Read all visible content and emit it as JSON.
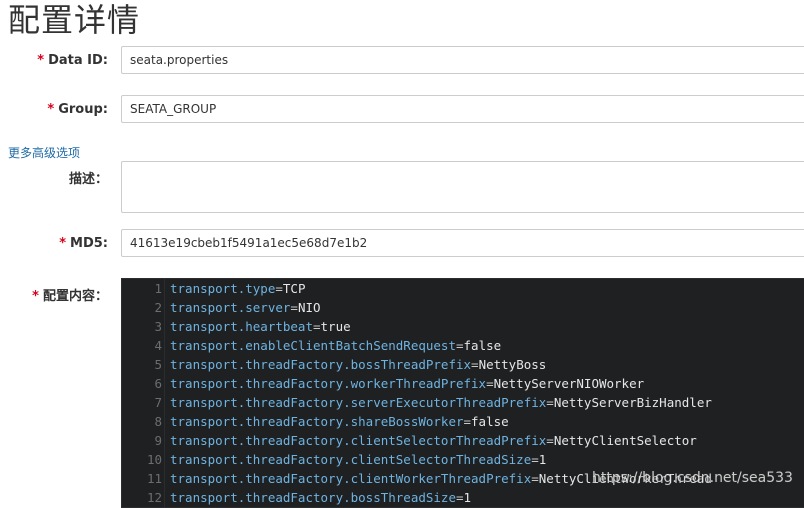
{
  "page_title": "配置详情",
  "form": {
    "data_id": {
      "label": "Data ID:",
      "value": "seata.properties"
    },
    "group": {
      "label": "Group:",
      "value": "SEATA_GROUP"
    },
    "advanced_link": "更多高级选项",
    "description": {
      "label": "描述：",
      "value": ""
    },
    "md5": {
      "label": "MD5:",
      "value": "41613e19cbeb1f5491a1ec5e68d7e1b2"
    },
    "content": {
      "label": "配置内容："
    },
    "required_mark": "*"
  },
  "editor": {
    "lines": [
      {
        "no": "1",
        "key": "transport.type",
        "value": "TCP"
      },
      {
        "no": "2",
        "key": "transport.server",
        "value": "NIO"
      },
      {
        "no": "3",
        "key": "transport.heartbeat",
        "value": "true"
      },
      {
        "no": "4",
        "key": "transport.enableClientBatchSendRequest",
        "value": "false"
      },
      {
        "no": "5",
        "key": "transport.threadFactory.bossThreadPrefix",
        "value": "NettyBoss"
      },
      {
        "no": "6",
        "key": "transport.threadFactory.workerThreadPrefix",
        "value": "NettyServerNIOWorker"
      },
      {
        "no": "7",
        "key": "transport.threadFactory.serverExecutorThreadPrefix",
        "value": "NettyServerBizHandler"
      },
      {
        "no": "8",
        "key": "transport.threadFactory.shareBossWorker",
        "value": "false"
      },
      {
        "no": "9",
        "key": "transport.threadFactory.clientSelectorThreadPrefix",
        "value": "NettyClientSelector"
      },
      {
        "no": "10",
        "key": "transport.threadFactory.clientSelectorThreadSize",
        "value": "1"
      },
      {
        "no": "11",
        "key": "transport.threadFactory.clientWorkerThreadPrefix",
        "value": "NettyClientWorkerThread"
      },
      {
        "no": "12",
        "key": "transport.threadFactory.bossThreadSize",
        "value": "1"
      }
    ]
  },
  "watermark": "https://blog.csdn.net/sea533"
}
